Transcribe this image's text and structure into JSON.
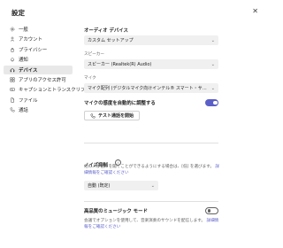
{
  "window": {
    "title": "設定"
  },
  "sidebar": {
    "items": [
      {
        "label": "一般",
        "icon": "gear-icon"
      },
      {
        "label": "アカウント",
        "icon": "person-icon"
      },
      {
        "label": "プライバシー",
        "icon": "lock-icon"
      },
      {
        "label": "通知",
        "icon": "bell-icon"
      },
      {
        "label": "デバイス",
        "icon": "headset-icon",
        "active": true
      },
      {
        "label": "アプリのアクセス許可",
        "icon": "grid-icon"
      },
      {
        "label": "キャプションとトランスクリプト",
        "icon": "captions-icon"
      },
      {
        "label": "ファイル",
        "icon": "file-icon"
      },
      {
        "label": "通話",
        "icon": "phone-icon"
      }
    ]
  },
  "audio": {
    "section_title": "オーディオ デバイス",
    "device_value": "カスタム セットアップ",
    "speaker_label": "スピーカー",
    "speaker_value": "スピーカー (Realtek(R) Audio)",
    "mic_label": "マイク",
    "mic_value": "マイク配列 (デジタルマイク向けインテル® スマート・サウンド・テク...",
    "auto_adjust_label": "マイクの感度を自動的に調整する",
    "auto_adjust_on": true,
    "test_call_label": "テスト通話を開始"
  },
  "noise": {
    "title": "ノイズ抑制",
    "desc": "他の人が音声を聞くことができるようにする場合は、[低] を選びます。",
    "link": "詳細情報をご確認ください",
    "value": "自動 (既定)"
  },
  "music": {
    "title": "高品質のミュージック モード",
    "desc": "会議でオプションを使用して、音楽演奏のサウンドを配信します。",
    "link": "詳細情報をご確認ください",
    "on": false
  }
}
